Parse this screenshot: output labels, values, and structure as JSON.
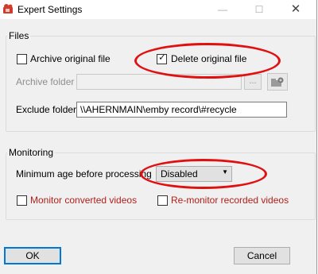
{
  "window": {
    "title": "Expert Settings",
    "min_glyph": "—",
    "max_glyph": "☐",
    "close_glyph": "✕"
  },
  "files": {
    "legend": "Files",
    "archive_original": {
      "label": "Archive original file",
      "checked": false
    },
    "delete_original": {
      "label": "Delete original file",
      "checked": true
    },
    "archive_folder": {
      "label": "Archive folder",
      "value": "",
      "browse_label": "..."
    },
    "exclude_folders": {
      "label": "Exclude folders",
      "value": "\\\\AHERNMAIN\\emby record\\#recycle"
    }
  },
  "monitoring": {
    "legend": "Monitoring",
    "min_age": {
      "label": "Minimum age before processing",
      "value": "Disabled"
    },
    "monitor_converted": {
      "label": "Monitor converted videos",
      "checked": false
    },
    "remonitor_recorded": {
      "label": "Re-monitor recorded videos",
      "checked": false
    }
  },
  "footer": {
    "ok_label": "OK",
    "cancel_label": "Cancel"
  },
  "annotation_color": "#e01010",
  "check_glyph": "✓",
  "dropdown_glyph": "▼"
}
